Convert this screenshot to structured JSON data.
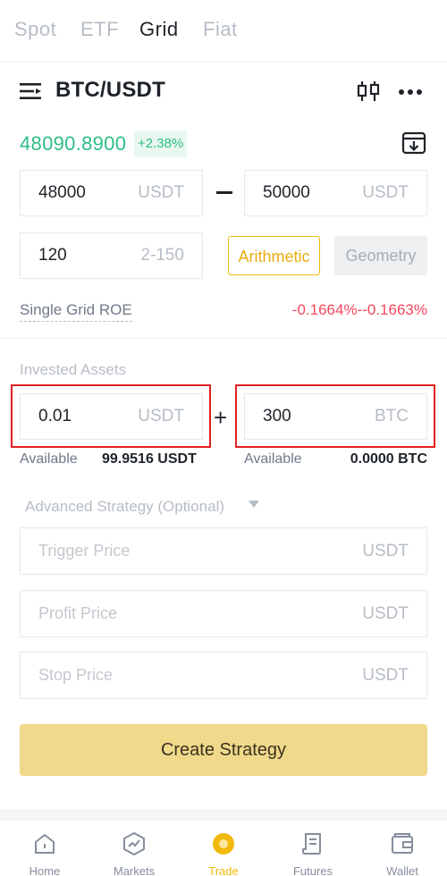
{
  "tabs": [
    {
      "label": "Spot"
    },
    {
      "label": "ETF"
    },
    {
      "label": "Grid"
    },
    {
      "label": "Fiat"
    }
  ],
  "header": {
    "pair": "BTC/USDT",
    "icons": [
      "menu-icon",
      "kline-icon",
      "more-icon"
    ]
  },
  "ticker": {
    "price": "48090.8900",
    "change": "+2.38%"
  },
  "range": {
    "lower_value": "48000",
    "lower_unit": "USDT",
    "upper_value": "50000",
    "upper_unit": "USDT"
  },
  "grid": {
    "count": "120",
    "hint": "2-150",
    "modes": [
      "Arithmetic",
      "Geometry"
    ],
    "selected_mode": "Arithmetic"
  },
  "roe": {
    "label": "Single Grid ROE",
    "value": "-0.1664%--0.1663%"
  },
  "invested": {
    "label": "Invested Assets",
    "usdt_value": "0.01",
    "usdt_unit": "USDT",
    "btc_value": "300",
    "btc_unit": "BTC",
    "available_label": "Available",
    "usdt_available": "99.9516 USDT",
    "btc_available": "0.0000 BTC"
  },
  "advanced": {
    "label": "Advanced Strategy (Optional)",
    "trigger_placeholder": "Trigger Price",
    "profit_placeholder": "Profit Price",
    "stop_placeholder": "Stop Price",
    "unit": "USDT"
  },
  "create_label": "Create Strategy",
  "nav": [
    {
      "label": "Home",
      "icon": "home-icon"
    },
    {
      "label": "Markets",
      "icon": "markets-icon"
    },
    {
      "label": "Trade",
      "icon": "trade-icon"
    },
    {
      "label": "Futures",
      "icon": "futures-icon"
    },
    {
      "label": "Wallet",
      "icon": "wallet-icon"
    }
  ],
  "colors": {
    "accent": "#f0b90b",
    "up": "#2ebd85",
    "down": "#f6465d",
    "highlight": "#e02020"
  }
}
